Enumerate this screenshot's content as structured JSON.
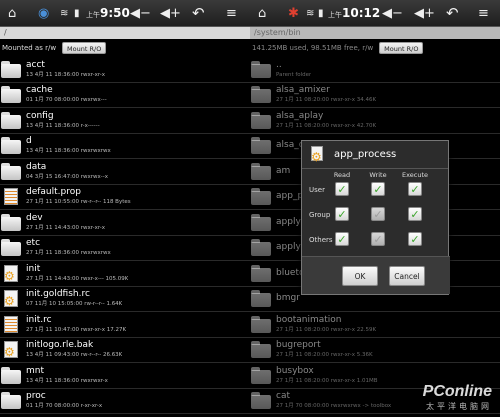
{
  "left": {
    "status": {
      "time": "9:50",
      "ampm": "上午"
    },
    "path": "/",
    "mount_label": "Mounted as r/w",
    "mount_button": "Mount R/O",
    "files": [
      {
        "name": "acct",
        "meta": "13 4月 11 18:36:00  rwxr-xr-x",
        "icon": "folder"
      },
      {
        "name": "cache",
        "meta": "01 1月 70 08:00:00  rwxrwx---",
        "icon": "folder"
      },
      {
        "name": "config",
        "meta": "13 4月 11 18:36:00  r-x------",
        "icon": "folder"
      },
      {
        "name": "d",
        "meta": "13 4月 11 18:36:00  rwxrwxrwx",
        "icon": "folder"
      },
      {
        "name": "data",
        "meta": "04 3月 15 16:47:00  rwxrwx--x",
        "icon": "folder"
      },
      {
        "name": "default.prop",
        "meta": "27 1月 11 10:55:00  rw-r--r--  118 Bytes",
        "icon": "text"
      },
      {
        "name": "dev",
        "meta": "27 1月 11 14:43:00  rwxr-xr-x",
        "icon": "folder"
      },
      {
        "name": "etc",
        "meta": "27 1月 11 18:36:00  rwxrwxrwx",
        "icon": "folder"
      },
      {
        "name": "init",
        "meta": "27 1月 11 14:43:00  rwxr-x---  105.09K",
        "icon": "gear"
      },
      {
        "name": "init.goldfish.rc",
        "meta": "07 11月 10 15:05:00  rw-r--r--  1.64K",
        "icon": "gear"
      },
      {
        "name": "init.rc",
        "meta": "27 1月 11 10:47:00  rwxr-xr-x  17.27K",
        "icon": "text"
      },
      {
        "name": "initlogo.rle.bak",
        "meta": "13 4月 11 09:43:00  rw-r--r--  26.63K",
        "icon": "gear"
      },
      {
        "name": "mnt",
        "meta": "13 4月 11 18:36:00  rwxrwxr-x",
        "icon": "folder"
      },
      {
        "name": "proc",
        "meta": "01 1月 70 08:00:00  r-xr-xr-x",
        "icon": "folder"
      }
    ]
  },
  "right": {
    "status": {
      "time": "10:12",
      "ampm": "上午"
    },
    "path": "/system/bin",
    "mount_label": "141.25MB used, 98.51MB free, r/w",
    "mount_button": "Mount R/O",
    "files": [
      {
        "name": "..",
        "meta": "Parent folder",
        "icon": "folder"
      },
      {
        "name": "alsa_amixer",
        "meta": "27 1月 11 08:20:00  rwxr-xr-x  34.46K",
        "icon": "folder"
      },
      {
        "name": "alsa_aplay",
        "meta": "27 1月 11 08:20:00  rwxr-xr-x  42.70K",
        "icon": "folder"
      },
      {
        "name": "alsa_ctl",
        "meta": "",
        "icon": "folder"
      },
      {
        "name": "am",
        "meta": "",
        "icon": "folder"
      },
      {
        "name": "app_p",
        "meta": "",
        "icon": "folder"
      },
      {
        "name": "applyp",
        "meta": "",
        "icon": "folder"
      },
      {
        "name": "applyp",
        "meta": "",
        "icon": "folder"
      },
      {
        "name": "blueto",
        "meta": "",
        "icon": "folder"
      },
      {
        "name": "bmgr",
        "meta": "",
        "icon": "folder"
      },
      {
        "name": "bootanimation",
        "meta": "27 1月 11 08:20:00  rwxr-xr-x  22.59K",
        "icon": "folder"
      },
      {
        "name": "bugreport",
        "meta": "27 1月 11 08:20:00  rwxr-xr-x  5.36K",
        "icon": "folder"
      },
      {
        "name": "busybox",
        "meta": "27 1月 11 08:20:00  rwxr-xr-x  1.01MB",
        "icon": "folder"
      },
      {
        "name": "cat",
        "meta": "27 1月 70 08:00:00  rwxrwxrwx  -> toolbox",
        "icon": "folder"
      }
    ]
  },
  "dialog": {
    "title": "app_process",
    "columns": [
      "Read",
      "Write",
      "Execute"
    ],
    "rows": [
      {
        "label": "User",
        "values": [
          "checked",
          "checked",
          "checked"
        ]
      },
      {
        "label": "Group",
        "values": [
          "checked",
          "disabled",
          "checked"
        ]
      },
      {
        "label": "Others",
        "values": [
          "checked",
          "disabled",
          "checked"
        ]
      }
    ],
    "ok": "OK",
    "cancel": "Cancel"
  },
  "watermark": {
    "brand": "PConline",
    "sub": "太平洋电脑网"
  }
}
